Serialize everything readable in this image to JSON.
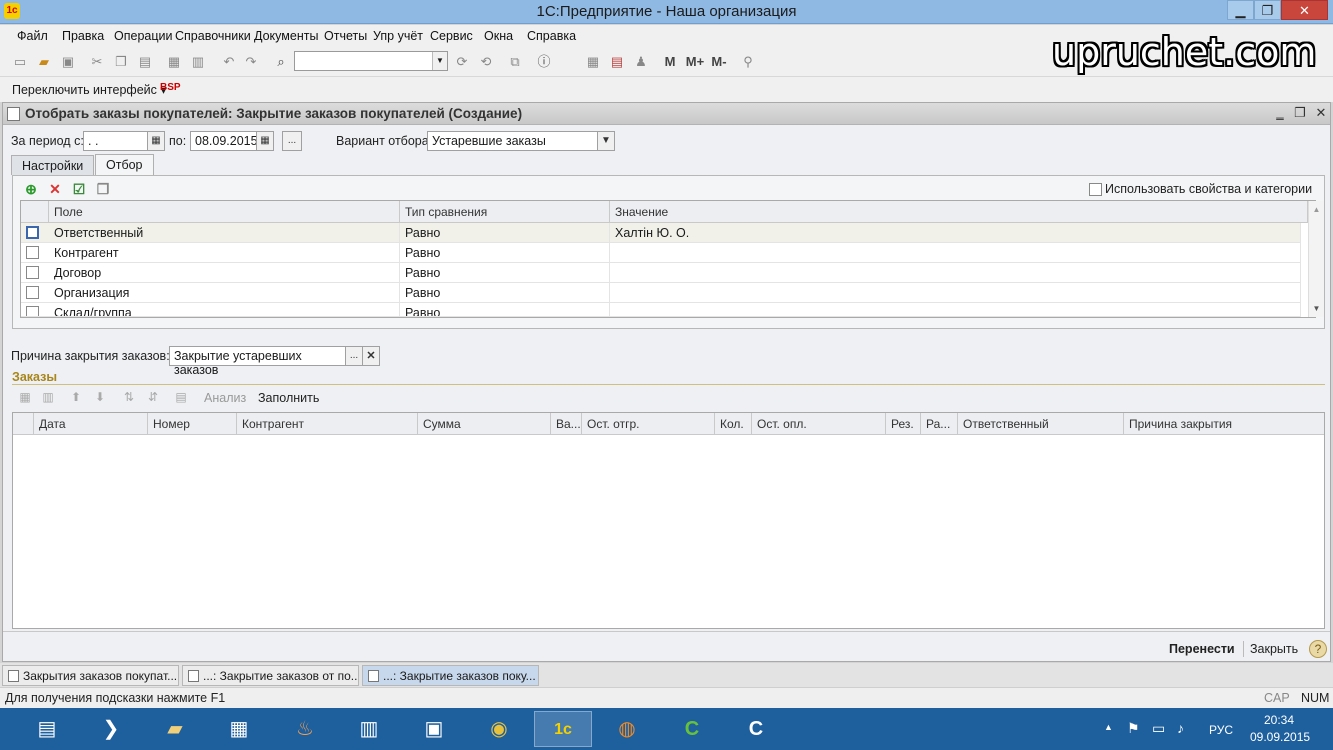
{
  "window": {
    "title": "1С:Предприятие - Наша организация",
    "min": "▁",
    "max": "❐",
    "close": "✕"
  },
  "menu": [
    "Файл",
    "Правка",
    "Операции",
    "Справочники",
    "Документы",
    "Отчеты",
    "Упр учёт",
    "Сервис",
    "Окна",
    "Справка"
  ],
  "toolbar": {
    "m": "М",
    "m_plus": "М+",
    "m_minus": "М-"
  },
  "watermark": "upruchet.com",
  "interface": {
    "switch_label": "Переключить интерфейс ▾",
    "bsp": "BSP"
  },
  "document": {
    "title": "Отобрать заказы покупателей: Закрытие заказов покупателей (Создание)",
    "period_from_label": "За период с:",
    "period_from_value": " . .",
    "period_to_label": "по:",
    "period_to_value": "08.09.2015",
    "variant_label": "Вариант отбора:",
    "variant_value": "Устаревшие заказы",
    "tabs": [
      "Настройки",
      "Отбор"
    ],
    "use_props_label": "Использовать свойства и категории",
    "filter_columns": [
      "Поле",
      "Тип сравнения",
      "Значение"
    ],
    "filter_rows": [
      {
        "field": "Ответственный",
        "cmp": "Равно",
        "value": "Халтін Ю. О."
      },
      {
        "field": "Контрагент",
        "cmp": "Равно",
        "value": ""
      },
      {
        "field": "Договор",
        "cmp": "Равно",
        "value": ""
      },
      {
        "field": "Организация",
        "cmp": "Равно",
        "value": ""
      },
      {
        "field": "Склад/группа",
        "cmp": "Равно",
        "value": ""
      }
    ],
    "reason_label": "Причина закрытия заказов:",
    "reason_value": "Закрытие устаревших заказов",
    "orders_title": "Заказы",
    "orders_analysis": "Анализ",
    "orders_fill": "Заполнить",
    "orders_columns": [
      "Дата",
      "Номер",
      "Контрагент",
      "Сумма",
      "Ва...",
      "Ост. отгр.",
      "Кол.",
      "Ост. опл.",
      "Рез.",
      "Ра...",
      "Ответственный",
      "Причина закрытия"
    ],
    "btn_transfer": "Перенести",
    "btn_close": "Закрыть"
  },
  "open_windows": [
    "Закрытия заказов покупат...",
    "...: Закрытие заказов от по...",
    "...: Закрытие заказов поку..."
  ],
  "status": {
    "hint": "Для получения подсказки нажмите F1",
    "cap": "CAP",
    "num": "NUM"
  },
  "tray": {
    "lang": "РУС",
    "time": "20:34",
    "date": "09.09.2015"
  }
}
